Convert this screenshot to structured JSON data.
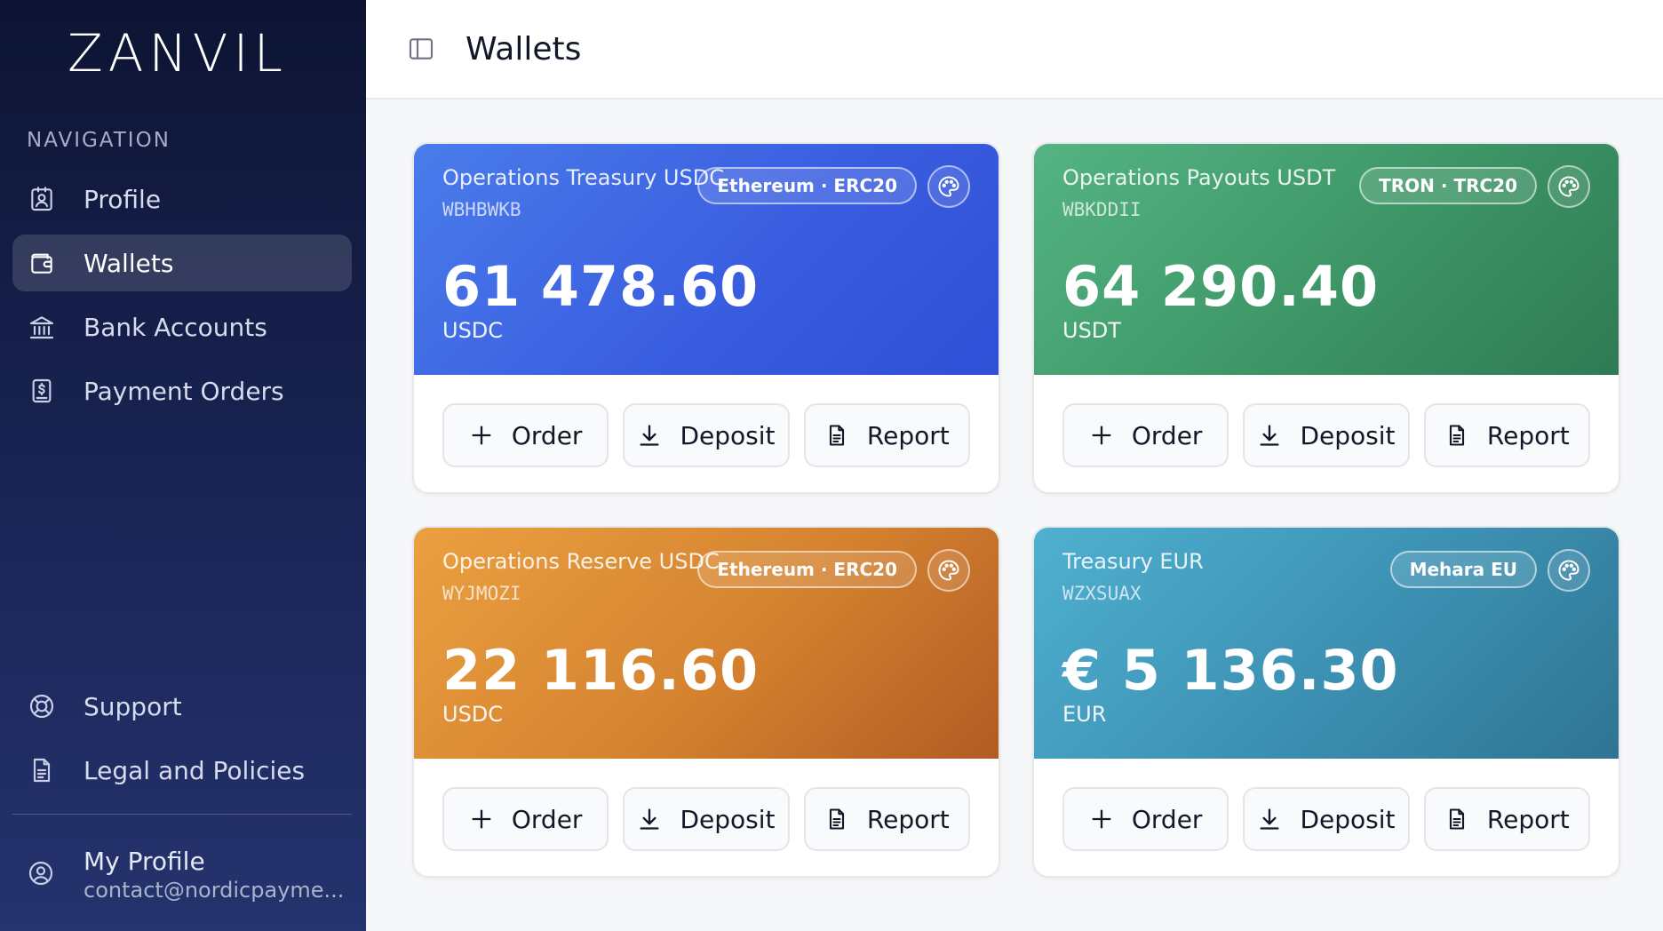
{
  "sidebar": {
    "logo": "ZANVIL",
    "nav_heading": "NAVIGATION",
    "items": [
      {
        "label": "Profile",
        "icon": "id-badge-icon"
      },
      {
        "label": "Wallets",
        "icon": "wallet-icon",
        "active": true
      },
      {
        "label": "Bank Accounts",
        "icon": "bank-icon"
      },
      {
        "label": "Payment Orders",
        "icon": "invoice-dollar-icon"
      }
    ],
    "bottom_items": [
      {
        "label": "Support",
        "icon": "lifebuoy-icon"
      },
      {
        "label": "Legal and Policies",
        "icon": "document-icon"
      }
    ],
    "profile": {
      "name": "My Profile",
      "email": "contact@nordicpayme..."
    }
  },
  "header": {
    "title": "Wallets"
  },
  "wallets": [
    {
      "name": "Operations Treasury USDC",
      "code": "WBHBWKB",
      "network": "Ethereum · ERC20",
      "amount": "61 478.60",
      "currency": "USDC",
      "color": "#3a5ee0"
    },
    {
      "name": "Operations Payouts USDT",
      "code": "WBKDDII",
      "network": "TRON · TRC20",
      "amount": "64 290.40",
      "currency": "USDT",
      "color": "#3d9566"
    },
    {
      "name": "Operations Reserve USDC",
      "code": "WYJMOZI",
      "network": "Ethereum · ERC20",
      "amount": "22 116.60",
      "currency": "USDC",
      "color": "#d4822f"
    },
    {
      "name": "Treasury EUR",
      "code": "WZXSUAX",
      "network": "Mehara EU",
      "amount": "€ 5 136.30",
      "currency": "EUR",
      "color": "#3c90b2"
    }
  ],
  "actions": {
    "order": "Order",
    "deposit": "Deposit",
    "report": "Report"
  }
}
